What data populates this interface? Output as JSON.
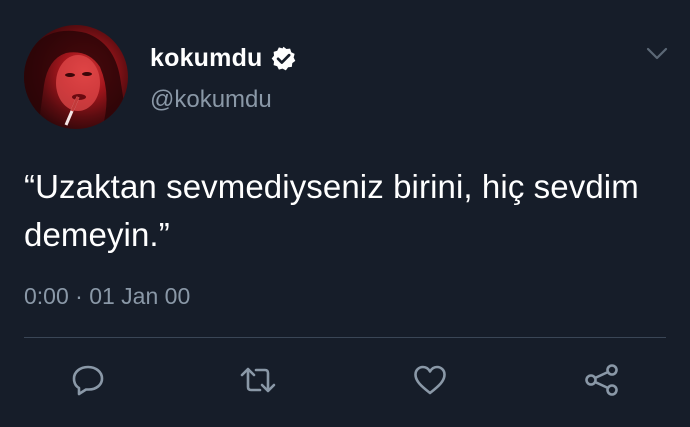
{
  "user": {
    "display_name": "kokumdu",
    "handle": "@kokumdu",
    "verified": true
  },
  "tweet": {
    "text": "“Uzaktan sevmediyseniz birini, hiç sevdim demeyin.”",
    "timestamp": "0:00 · 01 Jan 00"
  },
  "actions": [
    {
      "name": "reply",
      "icon": "reply-icon"
    },
    {
      "name": "retweet",
      "icon": "retweet-icon"
    },
    {
      "name": "like",
      "icon": "heart-icon"
    },
    {
      "name": "share",
      "icon": "share-icon"
    }
  ],
  "colors": {
    "background": "#161d29",
    "text_primary": "#ffffff",
    "text_secondary": "#8a98a7",
    "icon": "#8a98a7",
    "divider": "#3a4656",
    "avatar_accent": "#c8222a"
  }
}
